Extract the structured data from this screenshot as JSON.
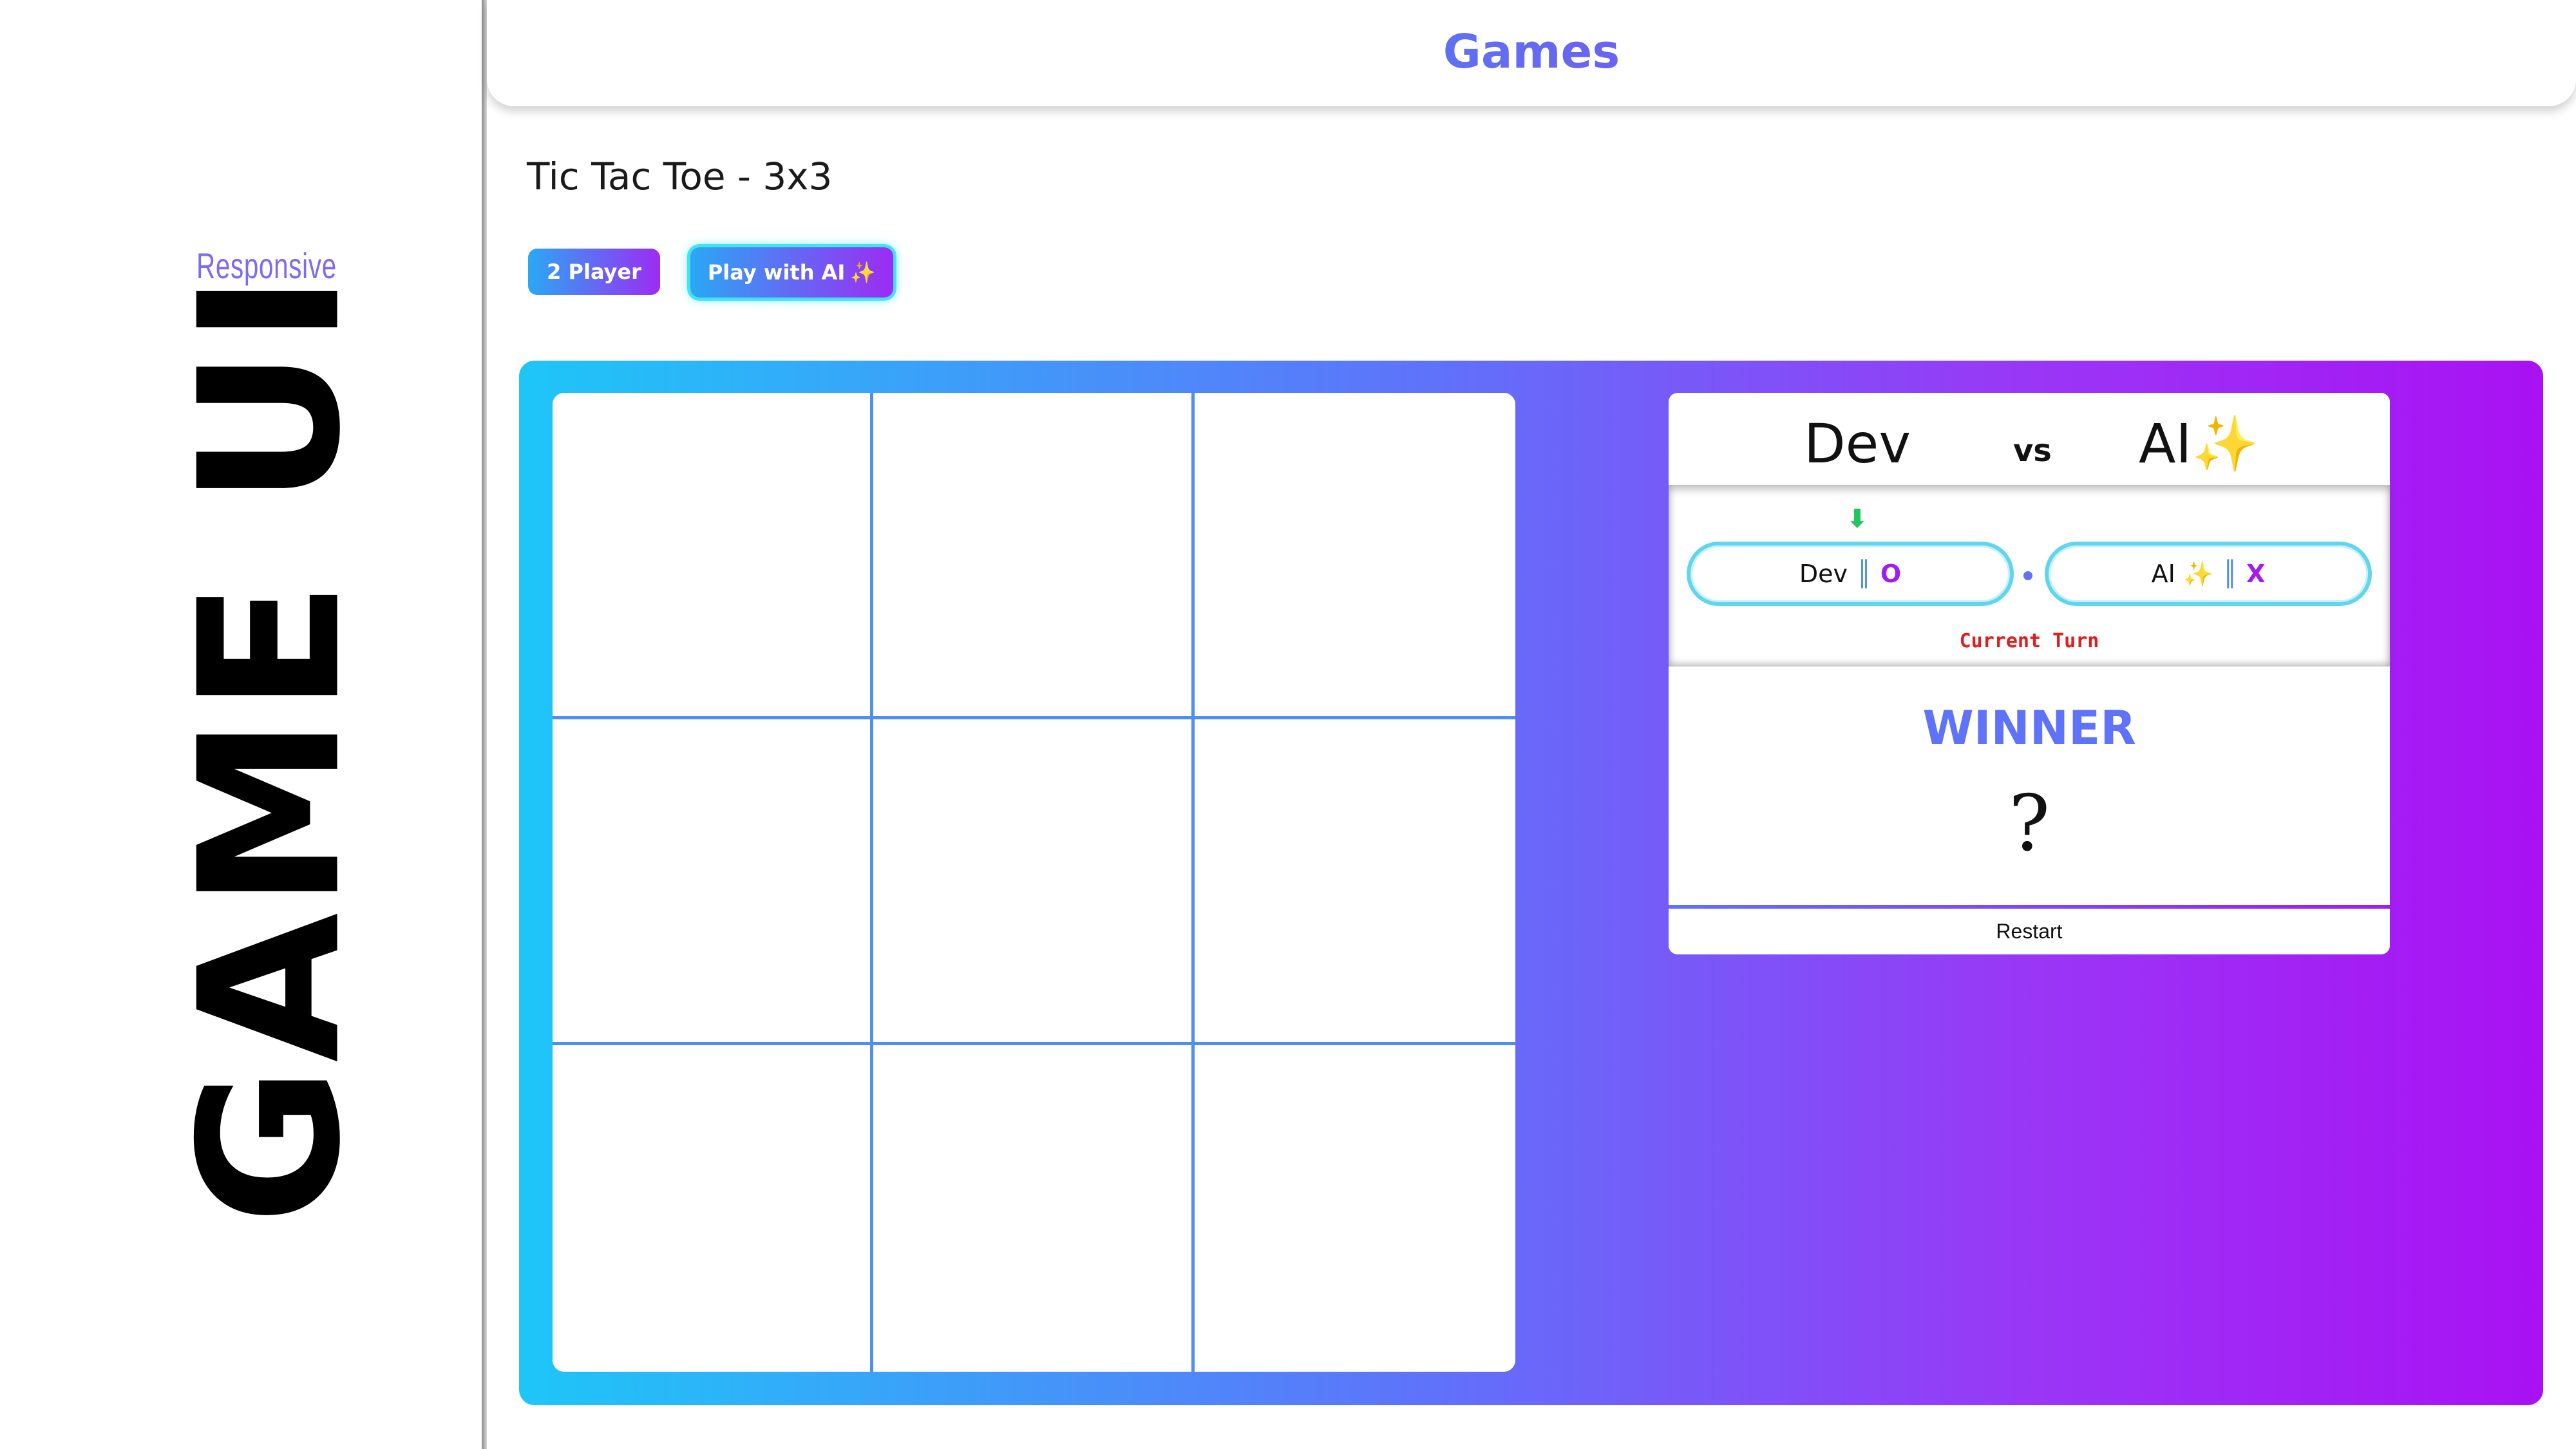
{
  "promo": {
    "subtitle": "Responsive",
    "title": "GAME UI"
  },
  "header": {
    "title": "Games"
  },
  "game": {
    "title": "Tic Tac Toe - 3x3",
    "modes": {
      "two_player": "2 Player",
      "ai": "Play with AI",
      "ai_emoji": "✨"
    },
    "board": {
      "rows": 3,
      "cols": 3,
      "cells": [
        "",
        "",
        "",
        "",
        "",
        "",
        "",
        "",
        ""
      ]
    }
  },
  "scoreboard": {
    "player1": "Dev",
    "vs": "vs",
    "player2": "AI",
    "player2_emoji": "✨",
    "current_turn_arrow": "⬇",
    "player1_pill": {
      "name": "Dev",
      "separator": "║",
      "mark": "O"
    },
    "player2_pill": {
      "name": "AI",
      "emoji": "✨",
      "separator": "║",
      "mark": "X"
    },
    "turn_label": "Current Turn",
    "winner_label": "WINNER",
    "winner_value": "?",
    "restart_label": "Restart"
  },
  "colors": {
    "gradient_start": "#1ec6f8",
    "gradient_end": "#a911f3",
    "grid_line": "#4f8ff0",
    "turn_text": "#e11d1d",
    "turn_arrow": "#22c55e"
  }
}
